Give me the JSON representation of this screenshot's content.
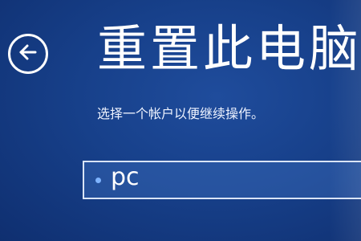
{
  "header": {
    "back_icon": "back-arrow-icon",
    "title": "重置此电脑"
  },
  "instruction": "选择一个帐户以便继续操作。",
  "accounts": [
    {
      "icon": "bullet-icon",
      "name": "pc"
    }
  ],
  "colors": {
    "background": "#17408a",
    "accent": "#7fb4ff",
    "text": "#ffffff"
  }
}
